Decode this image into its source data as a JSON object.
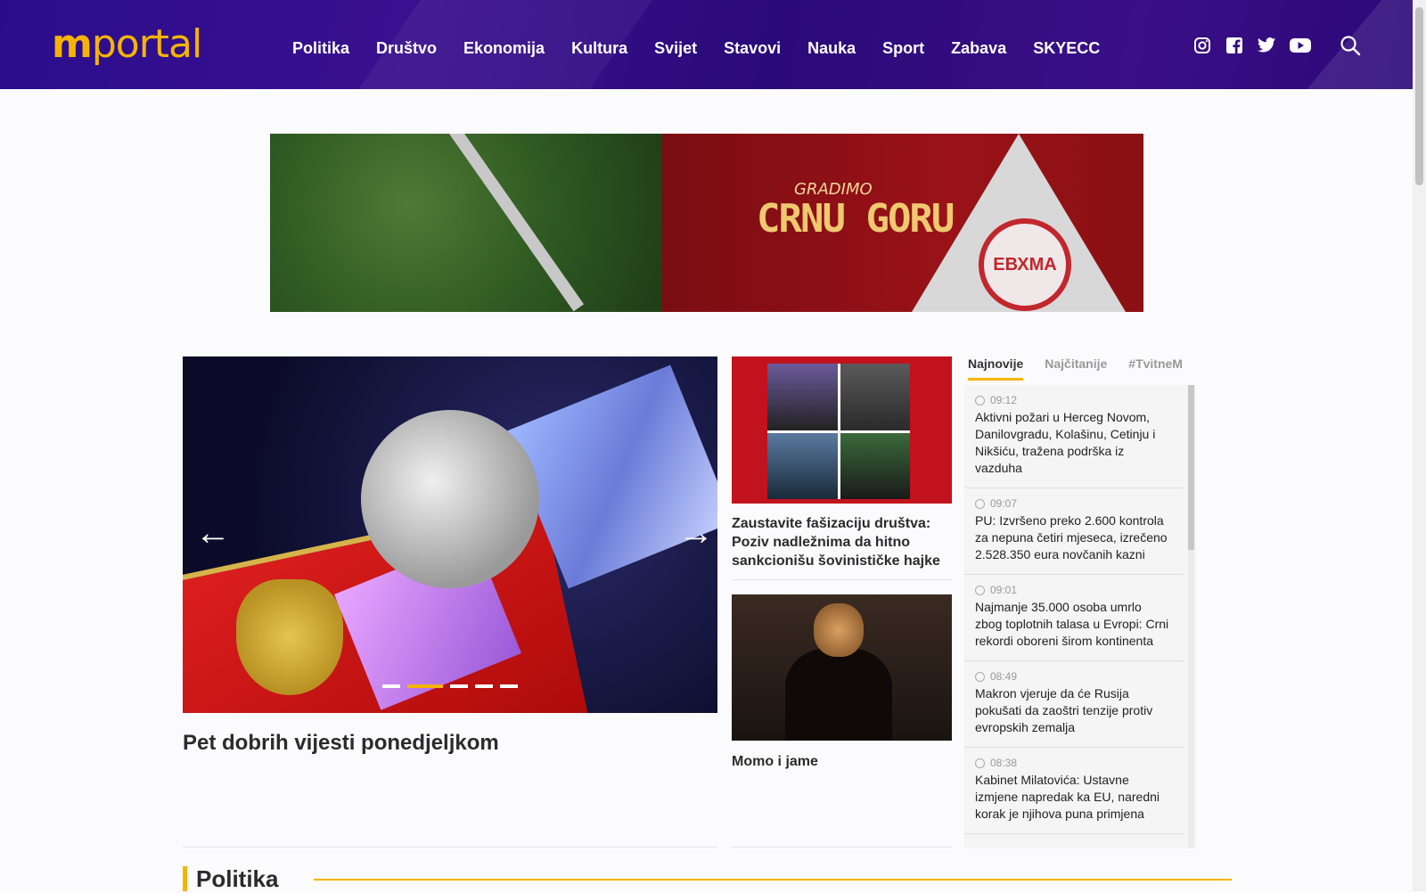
{
  "header": {
    "logo_bold": "m",
    "logo_rest": "portal",
    "nav": [
      "Politika",
      "Društvo",
      "Ekonomija",
      "Kultura",
      "Svijet",
      "Stavovi",
      "Nauka",
      "Sport",
      "Zabava",
      "SKYECC"
    ],
    "social_icons": [
      "instagram-icon",
      "facebook-icon",
      "twitter-icon",
      "youtube-icon"
    ],
    "search_icon": "search-icon"
  },
  "banner": {
    "line1": "GRADIMO",
    "line2": "CRNU GORU",
    "seal": "ЕВХМА"
  },
  "hero": {
    "title": "Pet dobrih vijesti ponedjeljkom",
    "prev": "←",
    "next": "→",
    "slides": 5,
    "active_slide": 2
  },
  "cards": [
    {
      "title": "Zaustavite fašizaciju društva: Poziv nadležnima da hitno sankcionišu šovinističke hajke"
    },
    {
      "title": "Momo i jame"
    }
  ],
  "sidebar": {
    "tabs": [
      "Najnovije",
      "Najčitanije",
      "#TvitneM"
    ],
    "active_tab": "Najnovije",
    "items": [
      {
        "time": "09:12",
        "text": "Aktivni požari u Herceg Novom, Danilovgradu, Kolašinu, Cetinju i Nikšiću, tražena podrška iz vazduha"
      },
      {
        "time": "09:07",
        "text": "PU: Izvršeno preko 2.600 kontrola za nepuna četiri mjeseca, izrečeno 2.528.350 eura novčanih kazni"
      },
      {
        "time": "09:01",
        "text": "Najmanje 35.000 osoba umrlo zbog toplotnih talasa u Evropi: Crni rekordi oboreni širom kontinenta"
      },
      {
        "time": "08:49",
        "text": "Makron vjeruje da će Rusija pokušati da zaoštri tenzije protiv evropskih zemalja"
      },
      {
        "time": "08:38",
        "text": "Kabinet Milatovića: Ustavne izmjene napredak ka EU, naredni korak je njihova puna primjena"
      }
    ]
  },
  "section": {
    "title": "Politika"
  },
  "colors": {
    "header_bg": "#2b0d8c",
    "accent": "#f5b400"
  }
}
